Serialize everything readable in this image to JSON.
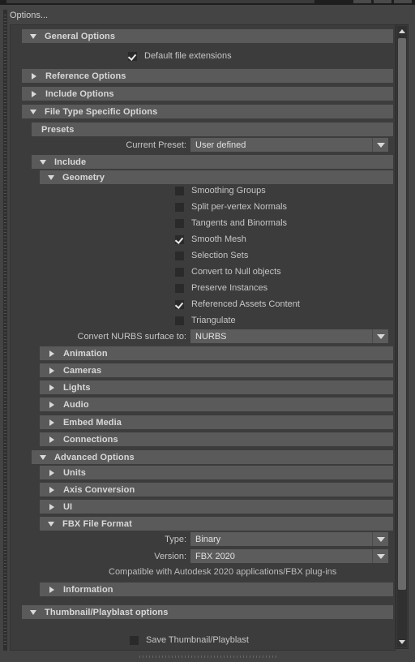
{
  "window": {
    "chrome_buttons": [
      "minimize",
      "maximize",
      "close"
    ]
  },
  "dialog": {
    "title": "Options...",
    "scrollbar": {
      "up_arrow": "scroll-up-arrow",
      "down_arrow": "scroll-down-arrow"
    }
  },
  "sections": {
    "general_options": {
      "label": "General Options",
      "expanded": true
    },
    "reference_options": {
      "label": "Reference Options",
      "expanded": false
    },
    "include_options": {
      "label": "Include Options",
      "expanded": false
    },
    "file_type_specific_options": {
      "label": "File Type Specific Options",
      "expanded": true
    },
    "presets": {
      "label": "Presets"
    },
    "include": {
      "label": "Include",
      "expanded": true
    },
    "geometry": {
      "label": "Geometry",
      "expanded": true
    },
    "animation": {
      "label": "Animation",
      "expanded": false
    },
    "cameras": {
      "label": "Cameras",
      "expanded": false
    },
    "lights": {
      "label": "Lights",
      "expanded": false
    },
    "audio": {
      "label": "Audio",
      "expanded": false
    },
    "embed_media": {
      "label": "Embed Media",
      "expanded": false
    },
    "connections": {
      "label": "Connections",
      "expanded": false
    },
    "advanced_options": {
      "label": "Advanced Options",
      "expanded": true
    },
    "units": {
      "label": "Units",
      "expanded": false
    },
    "axis_conversion": {
      "label": "Axis Conversion",
      "expanded": false
    },
    "ui": {
      "label": "UI",
      "expanded": false
    },
    "fbx_file_format": {
      "label": "FBX File Format",
      "expanded": true
    },
    "information": {
      "label": "Information",
      "expanded": false
    },
    "thumbnail_playblast_options": {
      "label": "Thumbnail/Playblast options",
      "expanded": true
    }
  },
  "general": {
    "default_file_extensions": {
      "label": "Default file extensions",
      "checked": true
    }
  },
  "presets_fields": {
    "current_preset": {
      "label": "Current Preset:",
      "value": "User defined"
    }
  },
  "geometry_checkboxes": [
    {
      "label": "Smoothing Groups",
      "checked": false
    },
    {
      "label": "Split per-vertex Normals",
      "checked": false
    },
    {
      "label": "Tangents and Binormals",
      "checked": false
    },
    {
      "label": "Smooth Mesh",
      "checked": true
    },
    {
      "label": "Selection Sets",
      "checked": false
    },
    {
      "label": "Convert to Null objects",
      "checked": false
    },
    {
      "label": "Preserve Instances",
      "checked": false
    },
    {
      "label": "Referenced Assets Content",
      "checked": true
    },
    {
      "label": "Triangulate",
      "checked": false
    }
  ],
  "geometry_fields": {
    "convert_nurbs": {
      "label": "Convert NURBS surface to:",
      "value": "NURBS"
    }
  },
  "fbx_format_fields": {
    "type": {
      "label": "Type:",
      "value": "Binary"
    },
    "version": {
      "label": "Version:",
      "value": "FBX 2020"
    },
    "compatibility_note": "Compatible with Autodesk 2020 applications/FBX plug-ins"
  },
  "thumbnail": {
    "save_thumbnail": {
      "label": "Save Thumbnail/Playblast",
      "checked": false
    }
  },
  "colors": {
    "dialog_bg": "#444444",
    "panel_bg": "#3c3c3c",
    "header_bg": "#5a5a5a",
    "field_bg": "#5c5c5c",
    "text": "#c8c8c8",
    "checkbox_bg": "#2a2a2a"
  }
}
